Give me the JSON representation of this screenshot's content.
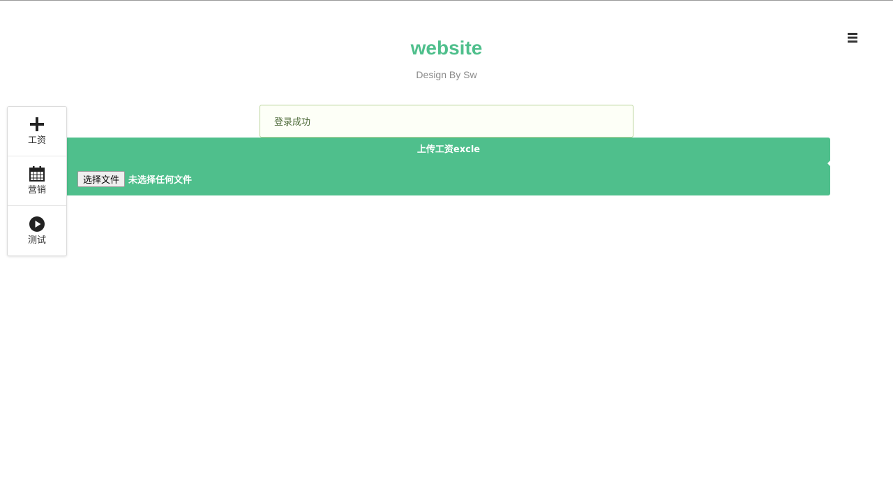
{
  "header": {
    "title": "website",
    "subtitle": "Design By Sw",
    "menu_icon": "hamburger-menu-icon"
  },
  "sidebar": {
    "items": [
      {
        "label": "工资",
        "icon": "plus-icon"
      },
      {
        "label": "营销",
        "icon": "calendar-icon"
      },
      {
        "label": "测试",
        "icon": "play-circle-icon"
      }
    ]
  },
  "alert": {
    "message": "登录成功"
  },
  "upload": {
    "title": "上传工资excle",
    "button_label": "选择文件",
    "status_text": "未选择任何文件"
  },
  "colors": {
    "accent": "#4fbf8c",
    "alert_border": "#b9d39a",
    "alert_background": "#fdfff7"
  }
}
